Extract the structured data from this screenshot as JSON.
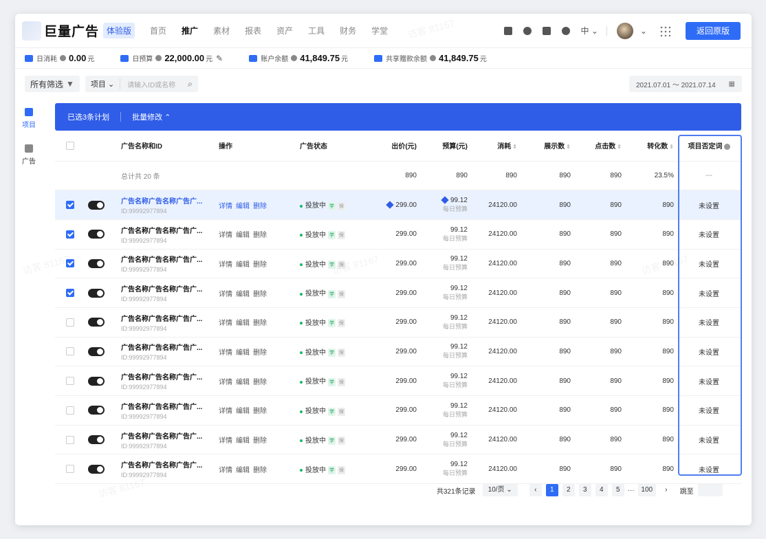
{
  "header": {
    "brand": "巨量广告",
    "edition_badge": "体验版",
    "nav": [
      "首页",
      "推广",
      "素材",
      "报表",
      "资产",
      "工具",
      "财务",
      "学堂"
    ],
    "active_nav": "推广",
    "language": "中",
    "return_button": "返回原版"
  },
  "budget": [
    {
      "label": "日消耗",
      "value": "0.00",
      "unit": "元"
    },
    {
      "label": "日预算",
      "value": "22,000.00",
      "unit": "元"
    },
    {
      "label": "账户余额",
      "value": "41,849.75",
      "unit": "元"
    },
    {
      "label": "共享赠款余额",
      "value": "41,849.75",
      "unit": "元"
    }
  ],
  "filter": {
    "all_filters": "所有筛选",
    "scope": "项目",
    "search_placeholder": "请输入ID或名称",
    "date_range": "2021.07.01  ～  2021.07.14"
  },
  "sidebar": [
    {
      "label": "项目",
      "active": true
    },
    {
      "label": "广告",
      "active": false
    }
  ],
  "bulk": {
    "selected": "已选3条计划",
    "edit": "批量修改 ⌃"
  },
  "table": {
    "headers": [
      "广告名称和ID",
      "操作",
      "广告状态",
      "出价(元)",
      "预算(元)",
      "消耗",
      "展示数",
      "点击数",
      "转化数",
      "项目否定词"
    ],
    "total_row": {
      "label": "总计共 20 条",
      "bid": "890",
      "budget": "890",
      "cost": "890",
      "impr": "890",
      "click": "890",
      "conv": "23.5%",
      "neg": "---"
    },
    "row_name": "广告名称广告名称广告广...",
    "row_id": "ID:99992977894",
    "ops": [
      "详情",
      "编辑",
      "删除"
    ],
    "status": "投放中",
    "tag1": "学",
    "tag2": "保",
    "bid": "299.00",
    "budget": "99.12",
    "budget_sub": "每日预算",
    "cost": "24120.00",
    "impr": "890",
    "click": "890",
    "conv": "890",
    "neg": "未设置",
    "checked": [
      true,
      true,
      true,
      true,
      false,
      false,
      false,
      false,
      false,
      false
    ]
  },
  "pager": {
    "total": "共321条记录",
    "size": "10/页  ⌄",
    "pages": [
      "1",
      "2",
      "3",
      "4",
      "5"
    ],
    "ellipsis": "···",
    "last": "100",
    "jump": "跳至"
  },
  "watermark": "访客 81167",
  "colors": {
    "primary": "#2f6cf6",
    "bulk_bar": "#2f5de8",
    "selected_row": "#eaf2ff",
    "status_green": "#18b66a"
  }
}
